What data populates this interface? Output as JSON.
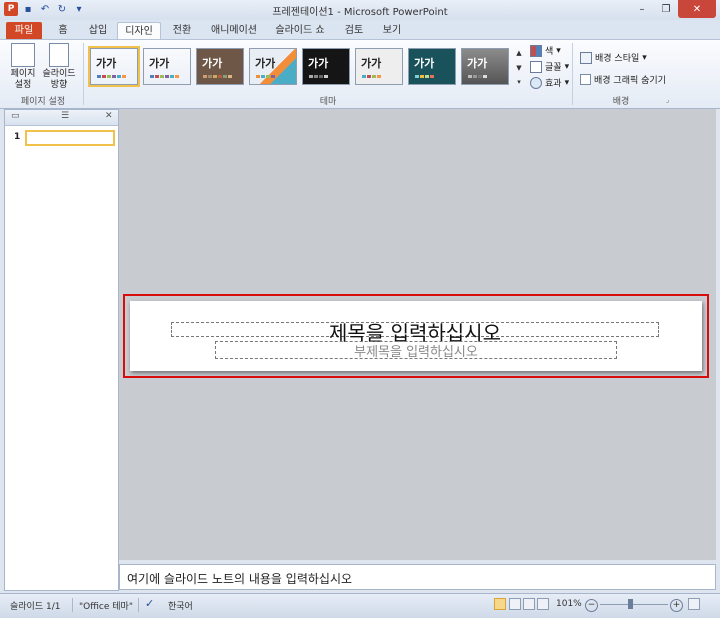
{
  "app": {
    "title": "프레젠테이션1 - Microsoft PowerPoint",
    "logo": "P",
    "colors": {
      "accent": "#d24726",
      "selection": "#f0c24b",
      "highlight": "#d80c0c"
    }
  },
  "qat": [
    {
      "name": "save-icon",
      "glyph": "▪"
    },
    {
      "name": "undo-icon",
      "glyph": "↶"
    },
    {
      "name": "redo-icon",
      "glyph": "↻"
    },
    {
      "name": "customize-qat-icon",
      "glyph": "▾"
    }
  ],
  "tabs": [
    {
      "label": "파일"
    },
    {
      "label": "홈"
    },
    {
      "label": "삽입"
    },
    {
      "label": "디자인"
    },
    {
      "label": "전환"
    },
    {
      "label": "애니메이션"
    },
    {
      "label": "슬라이드 쇼"
    },
    {
      "label": "검토"
    },
    {
      "label": "보기"
    }
  ],
  "ribbon": {
    "page_setup": {
      "page_setup_btn": "페이지 설정",
      "orientation_btn": "슬라이드 방향",
      "label": "페이지 설정"
    },
    "themes": {
      "label": "테마",
      "items": [
        {
          "text": "가가",
          "bg": "#ffffff",
          "fg": "#222222",
          "selected": true
        },
        {
          "text": "가가",
          "bg": "#ffffff",
          "fg": "#222222",
          "selected": false
        },
        {
          "text": "가가",
          "bg": "#6e5747",
          "fg": "#ffffff",
          "selected": false
        },
        {
          "text": "가가",
          "bg": "#e8eef4",
          "fg": "#222222",
          "selected": false
        },
        {
          "text": "가가",
          "bg": "#151515",
          "fg": "#ffffff",
          "selected": false
        },
        {
          "text": "가가",
          "bg": "#eeeeee",
          "fg": "#222222",
          "selected": false
        },
        {
          "text": "가가",
          "bg": "#19525b",
          "fg": "#ffffff",
          "selected": false
        },
        {
          "text": "가가",
          "bg": "#6d6d6d",
          "fg": "#ffffff",
          "selected": false
        }
      ],
      "colors": "색",
      "fonts": "글꼴",
      "effects": "효과"
    },
    "background": {
      "style": "배경 스타일",
      "hide_graphics": "배경 그래픽 숨기기",
      "label": "배경"
    }
  },
  "slides_pane": {
    "slide_number": "1"
  },
  "slide": {
    "title_placeholder": "제목을 입력하십시오",
    "subtitle_placeholder": "부제목을 입력하십시오"
  },
  "notes": {
    "placeholder": "여기에 슬라이드 노트의 내용을 입력하십시오"
  },
  "status": {
    "slide_info": "슬라이드 1/1",
    "theme": "\"Office 테마\"",
    "language": "한국어",
    "zoom": "101%"
  }
}
